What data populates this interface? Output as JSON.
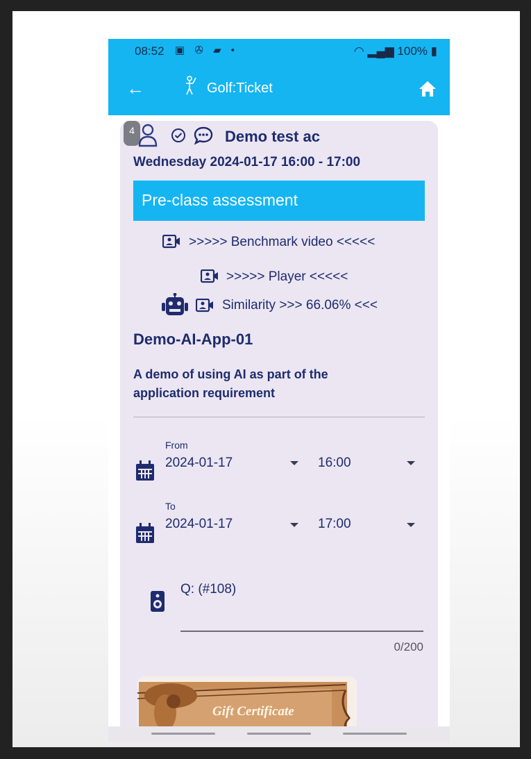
{
  "status_bar": {
    "time": "08:52",
    "signal_and_battery": "100%"
  },
  "app_bar": {
    "title": "Golf:Ticket"
  },
  "card": {
    "badge_count": "4",
    "name": "Demo test ac",
    "datetime": "Wednesday 2024-01-17 16:00 - 17:00",
    "section_header": "Pre-class assessment",
    "benchmark_link": ">>>>> Benchmark video <<<<<",
    "player_link": ">>>>> Player <<<<<",
    "similarity_link": "Similarity >>> 66.06% <<<",
    "app_name": "Demo-AI-App-01",
    "description": "A demo of using AI as part of the application requirement"
  },
  "form": {
    "from_label": "From",
    "from_date": "2024-01-17",
    "from_time": "16:00",
    "to_label": "To",
    "to_date": "2024-01-17",
    "to_time": "17:00",
    "question_label": "Q: (#108)",
    "char_counter": "0/200"
  },
  "gift_card": {
    "caption": "Gift Certificate"
  },
  "colors": {
    "accent": "#15b5f2",
    "navy": "#1e2b6e",
    "card_bg": "#ebe6f2"
  }
}
